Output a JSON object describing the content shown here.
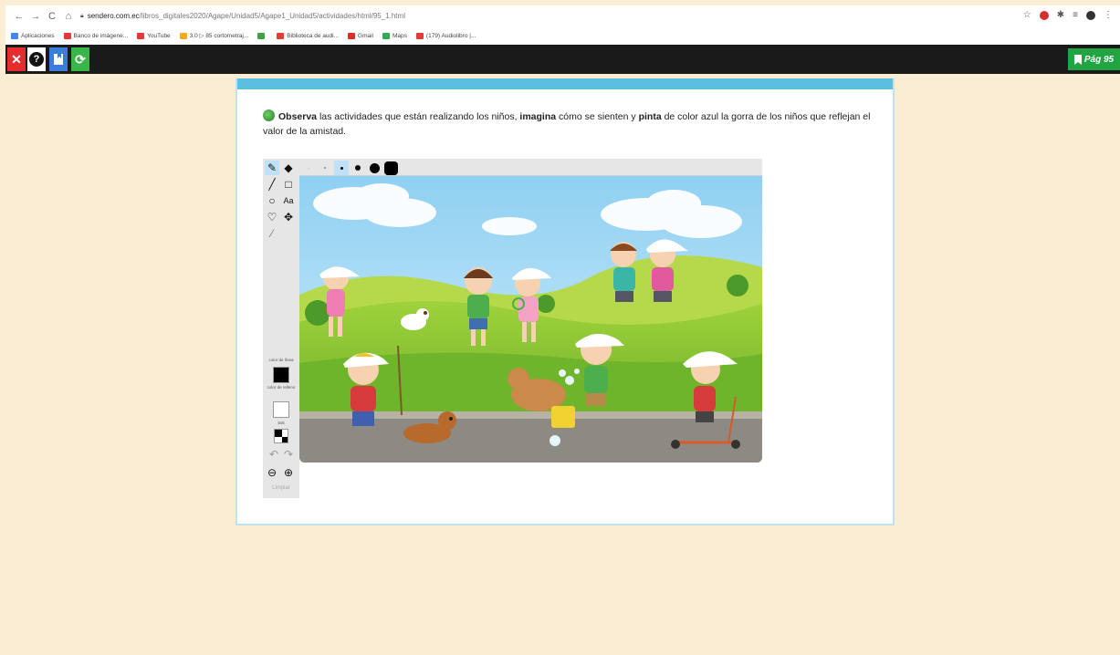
{
  "browser": {
    "url_host": "sendero.com.ec",
    "url_path": "/libros_digitales2020/Agape/Unidad5/Agape1_Unidad5/actividades/html/95_1.html",
    "bookmarks": [
      {
        "label": "Aplicaciones",
        "icon_color": "#4285f4"
      },
      {
        "label": "Banco de imágene...",
        "icon_color": "#e53935"
      },
      {
        "label": "YouTube",
        "icon_color": "#e53935"
      },
      {
        "label": "3.0 ▷ 85 cortometraj...",
        "icon_color": "#f9a825"
      },
      {
        "label": "",
        "icon_color": "#43a047"
      },
      {
        "label": "Biblioteca de audi...",
        "icon_color": "#e53935"
      },
      {
        "label": "Gmail",
        "icon_color": "#d93025"
      },
      {
        "label": "Maps",
        "icon_color": "#34a853"
      },
      {
        "label": "(179) Audiolibro |...",
        "icon_color": "#e53935"
      }
    ]
  },
  "toolbar": {
    "close_label": "✕",
    "help_label": "?",
    "page_label": "Pág 95"
  },
  "instructions": {
    "part1_bold": "Observa",
    "part2": " las actividades que están realizando los niños, ",
    "part3_bold": "imagina",
    "part4": " cómo se sienten y ",
    "part5_bold": "pinta",
    "part6": " de color azul la gorra de los niños que reflejan el valor de la amistad."
  },
  "paint": {
    "color_lines_label": "color de línea",
    "color_fill_label": "color de relleno",
    "size_label": "5x5",
    "clear_label": "Limpiar",
    "line_color": "#000000",
    "fill_color": "#ffffff"
  },
  "colors": {
    "accent": "#5bc0de",
    "toolbar_bg": "#1a1a1a",
    "page_button": "#21a542",
    "close_button": "#e52d2d",
    "save_button": "#3b7dd8",
    "refresh_button": "#3ab54a"
  }
}
